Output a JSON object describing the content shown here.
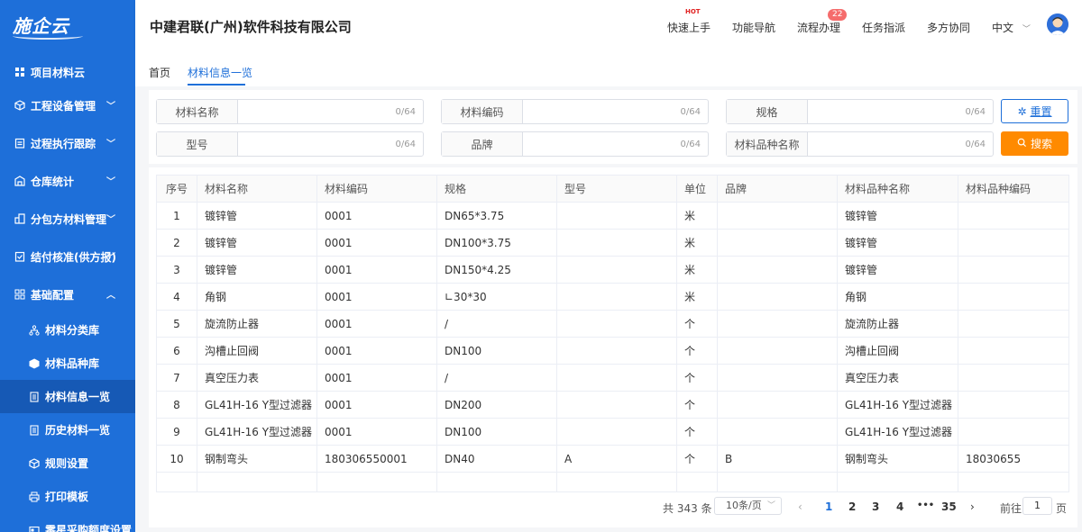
{
  "app": {
    "logo_text": "施企云"
  },
  "sidebar": {
    "section_title": "项目材料云",
    "items": [
      {
        "label": "工程设备管理",
        "icon": "box-icon"
      },
      {
        "label": "过程执行跟踪",
        "icon": "clipboard-icon"
      },
      {
        "label": "仓库统计",
        "icon": "warehouse-icon"
      },
      {
        "label": "分包方材料管理",
        "icon": "buildings-icon"
      },
      {
        "label": "结付核准(供方报)",
        "icon": "check-clipboard-icon"
      },
      {
        "label": "基础配置",
        "icon": "grid-icon"
      }
    ],
    "sub_items": [
      {
        "label": "材料分类库",
        "icon": "hierarchy-icon"
      },
      {
        "label": "材料品种库",
        "icon": "box-icon"
      },
      {
        "label": "材料信息一览",
        "icon": "document-icon"
      },
      {
        "label": "历史材料一览",
        "icon": "document-icon"
      },
      {
        "label": "规则设置",
        "icon": "cube-icon"
      },
      {
        "label": "打印模板",
        "icon": "printer-icon"
      },
      {
        "label": "零星采购额度设置",
        "icon": "card-icon"
      }
    ]
  },
  "header": {
    "company": "中建君联(广州)软件科技有限公司",
    "nav": [
      "快速上手",
      "功能导航",
      "流程办理",
      "任务指派",
      "多方协同"
    ],
    "hot_label": "HOT",
    "badge": "22",
    "language": "中文"
  },
  "tabs": [
    "首页",
    "材料信息一览"
  ],
  "filters": {
    "row1": [
      {
        "label": "材料名称",
        "count": "0/64"
      },
      {
        "label": "材料编码",
        "count": "0/64"
      },
      {
        "label": "规格",
        "count": "0/64"
      }
    ],
    "row2": [
      {
        "label": "型号",
        "count": "0/64"
      },
      {
        "label": "品牌",
        "count": "0/64"
      },
      {
        "label": "材料品种名称",
        "count": "0/64"
      }
    ],
    "reset_label": "重置",
    "search_label": "搜索"
  },
  "table": {
    "headers": [
      "序号",
      "材料名称",
      "材料编码",
      "规格",
      "型号",
      "单位",
      "品牌",
      "材料品种名称",
      "材料品种编码"
    ],
    "rows": [
      [
        "1",
        "镀锌管",
        "0001",
        "DN65*3.75",
        "",
        "米",
        "",
        "镀锌管",
        ""
      ],
      [
        "2",
        "镀锌管",
        "0001",
        "DN100*3.75",
        "",
        "米",
        "",
        "镀锌管",
        ""
      ],
      [
        "3",
        "镀锌管",
        "0001",
        "DN150*4.25",
        "",
        "米",
        "",
        "镀锌管",
        ""
      ],
      [
        "4",
        "角钢",
        "0001",
        "∟30*30",
        "",
        "米",
        "",
        "角钢",
        ""
      ],
      [
        "5",
        "旋流防止器",
        "0001",
        "/",
        "",
        "个",
        "",
        "旋流防止器",
        ""
      ],
      [
        "6",
        "沟槽止回阀",
        "0001",
        "DN100",
        "",
        "个",
        "",
        "沟槽止回阀",
        ""
      ],
      [
        "7",
        "真空压力表",
        "0001",
        "/",
        "",
        "个",
        "",
        "真空压力表",
        ""
      ],
      [
        "8",
        "GL41H-16 Y型过滤器",
        "0001",
        "DN200",
        "",
        "个",
        "",
        "GL41H-16 Y型过滤器",
        ""
      ],
      [
        "9",
        "GL41H-16 Y型过滤器",
        "0001",
        "DN100",
        "",
        "个",
        "",
        "GL41H-16 Y型过滤器",
        ""
      ],
      [
        "10",
        "钢制弯头",
        "180306550001",
        "DN40",
        "A",
        "个",
        "B",
        "钢制弯头",
        "18030655"
      ]
    ]
  },
  "pagination": {
    "total": "共 343 条",
    "page_size": "10条/页",
    "pages": [
      "1",
      "2",
      "3",
      "4",
      "•••",
      "35"
    ],
    "goto_label": "前往",
    "goto_value": "1",
    "page_suffix": "页"
  }
}
